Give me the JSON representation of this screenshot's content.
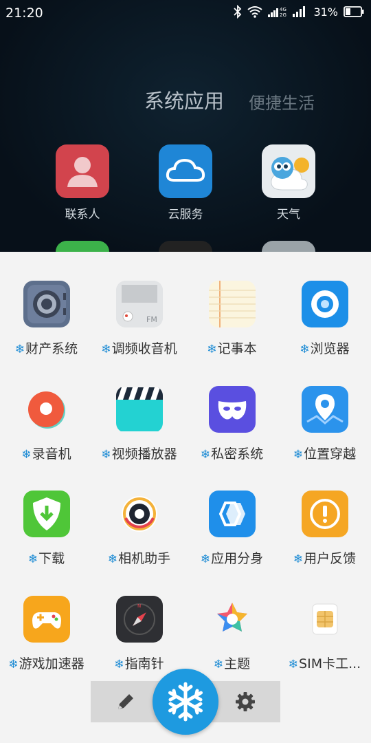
{
  "status_bar": {
    "time": "21:20",
    "battery": "31%",
    "network": "4G"
  },
  "tabs": [
    {
      "label": "系统应用"
    },
    {
      "label": "便捷生活"
    }
  ],
  "top_apps": [
    {
      "label": "联系人"
    },
    {
      "label": "云服务"
    },
    {
      "label": "天气"
    }
  ],
  "frozen_prefix": "❄",
  "apps": [
    {
      "label": "财产系统"
    },
    {
      "label": "调频收音机"
    },
    {
      "label": "记事本"
    },
    {
      "label": "浏览器"
    },
    {
      "label": "录音机"
    },
    {
      "label": "视频播放器"
    },
    {
      "label": "私密系统"
    },
    {
      "label": "位置穿越"
    },
    {
      "label": "下载"
    },
    {
      "label": "相机助手"
    },
    {
      "label": "应用分身"
    },
    {
      "label": "用户反馈"
    },
    {
      "label": "游戏加速器"
    },
    {
      "label": "指南针"
    },
    {
      "label": "主题"
    },
    {
      "label": "SIM卡工..."
    }
  ],
  "accent": "#1e9ae0"
}
